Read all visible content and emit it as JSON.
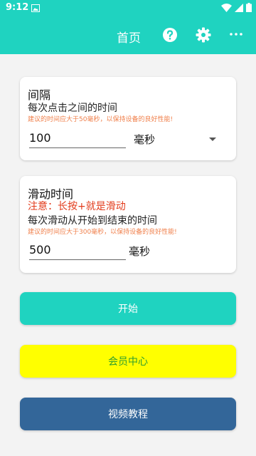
{
  "status": {
    "time": "9:12"
  },
  "appbar": {
    "title": "首页",
    "icons": [
      "help-icon",
      "gear-icon",
      "more-icon"
    ]
  },
  "interval_card": {
    "title": "间隔",
    "desc": "每次点击之间的时间",
    "hint": "建议的时间应大于50毫秒，以保持设备的良好性能!",
    "value": "100",
    "unit": "毫秒"
  },
  "swipe_card": {
    "title": "滑动时间",
    "warning": "注意：长按+就是滑动",
    "desc": "每次滑动从开始到结束的时间",
    "hint": "建议的时间应大于300毫秒，以保持设备的良好性能!",
    "value": "500",
    "unit": "毫秒"
  },
  "buttons": {
    "start": "开始",
    "vip": "会员中心",
    "video": "视频教程"
  },
  "colors": {
    "accent": "#1fd3c0",
    "hint": "#f0804c",
    "warning": "#e23a1a",
    "vip_bg": "#ffff00",
    "vip_text": "#2e9e2e",
    "video_bg": "#336699"
  }
}
